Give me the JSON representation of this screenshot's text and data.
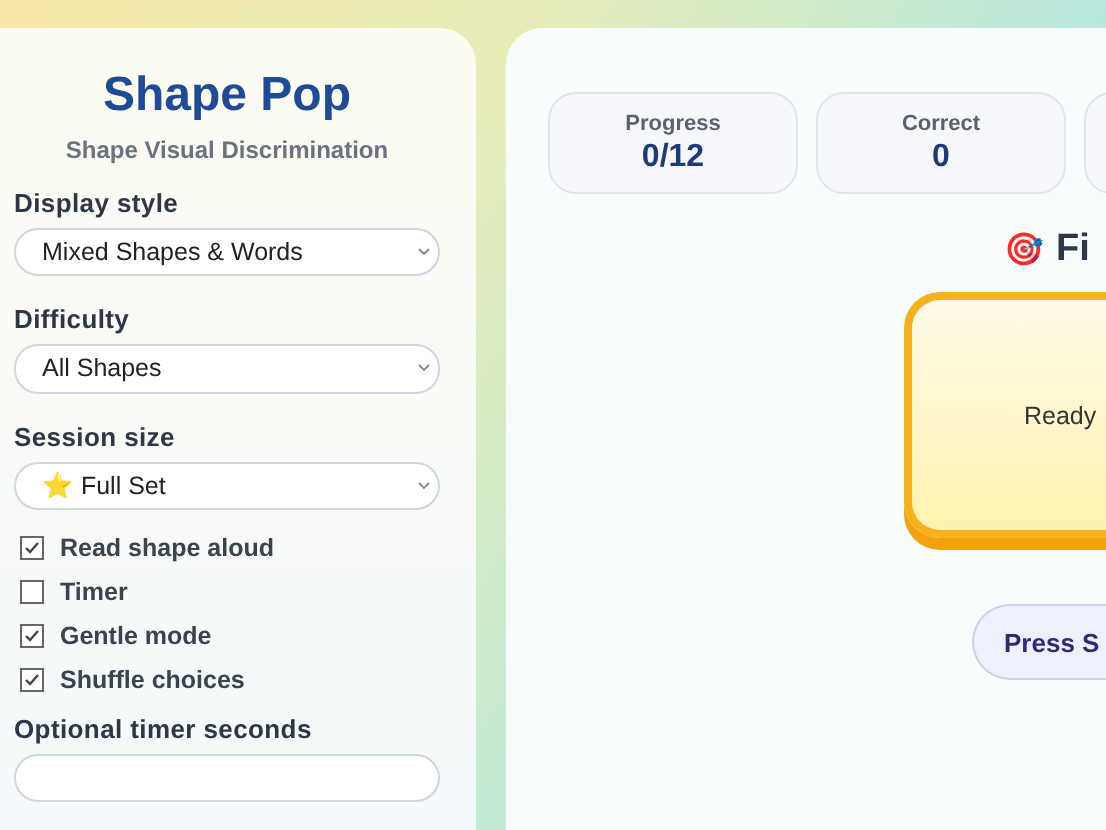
{
  "sidebar": {
    "title": "Shape Pop",
    "subtitle": "Shape Visual Discrimination",
    "fields": [
      {
        "label": "Display style",
        "value": "Mixed Shapes & Words"
      },
      {
        "label": "Difficulty",
        "value": "All Shapes"
      },
      {
        "label": "Session size",
        "value": "⭐ Full Set"
      }
    ],
    "options": [
      {
        "label": "Read shape aloud",
        "checked": true
      },
      {
        "label": "Timer",
        "checked": false
      },
      {
        "label": "Gentle mode",
        "checked": true
      },
      {
        "label": "Shuffle choices",
        "checked": true
      }
    ],
    "timer_label": "Optional timer seconds"
  },
  "stats": [
    {
      "label": "Progress",
      "value": "0/12"
    },
    {
      "label": "Correct",
      "value": "0"
    }
  ],
  "prompt": {
    "icon": "🎯",
    "text": "Fi"
  },
  "card": {
    "text": "Ready"
  },
  "start_button": "Press S"
}
